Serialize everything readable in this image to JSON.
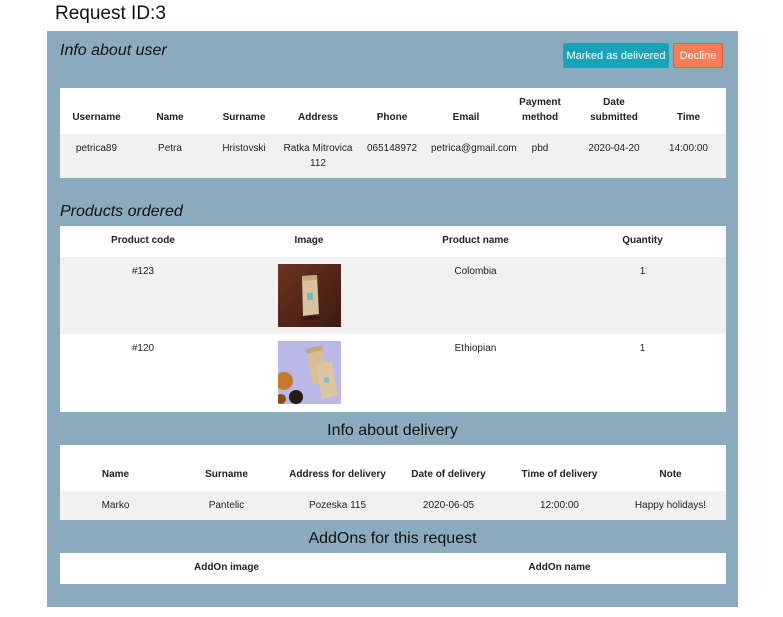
{
  "page": {
    "title": "Request ID:3"
  },
  "user_info": {
    "heading": "Info about user",
    "buttons": {
      "delivered": "Marked as delivered",
      "decline": "Decline"
    },
    "columns": [
      "Username",
      "Name",
      "Surname",
      "Address",
      "Phone",
      "Email",
      "Payment method",
      "Date submitted",
      "Time"
    ],
    "row": [
      "petrica89",
      "Petra",
      "Hristovski",
      "Ratka Mitrovica 112",
      "065148972",
      "petrica@gmail.com",
      "pbd",
      "2020-04-20",
      "14:00:00"
    ]
  },
  "products": {
    "heading": "Products ordered",
    "columns": [
      "Product code",
      "Image",
      "Product name",
      "Quantity"
    ],
    "rows": [
      {
        "code": "#123",
        "image": "coffee-bag-photo-dark",
        "name": "Colombia",
        "quantity": "1"
      },
      {
        "code": "#120",
        "image": "coffee-bag-photo-light",
        "name": "Ethiopian",
        "quantity": "1"
      }
    ]
  },
  "delivery": {
    "heading": "Info about delivery",
    "columns": [
      "Name",
      "Surname",
      "Address for delivery",
      "Date of delivery",
      "Time of delivery",
      "Note"
    ],
    "row": [
      "Marko",
      "Pantelic",
      "Pozeska 115",
      "2020-06-05",
      "12:00:00",
      "Happy holidays!"
    ]
  },
  "addons": {
    "heading": "AddOns for this request",
    "columns": [
      "AddOn image",
      "AddOn name"
    ]
  },
  "colors": {
    "panel": "#8aaabe",
    "delivered_button": "#1aa3b8",
    "decline_button": "#f87c58",
    "row_background": "#f1f1f1"
  }
}
